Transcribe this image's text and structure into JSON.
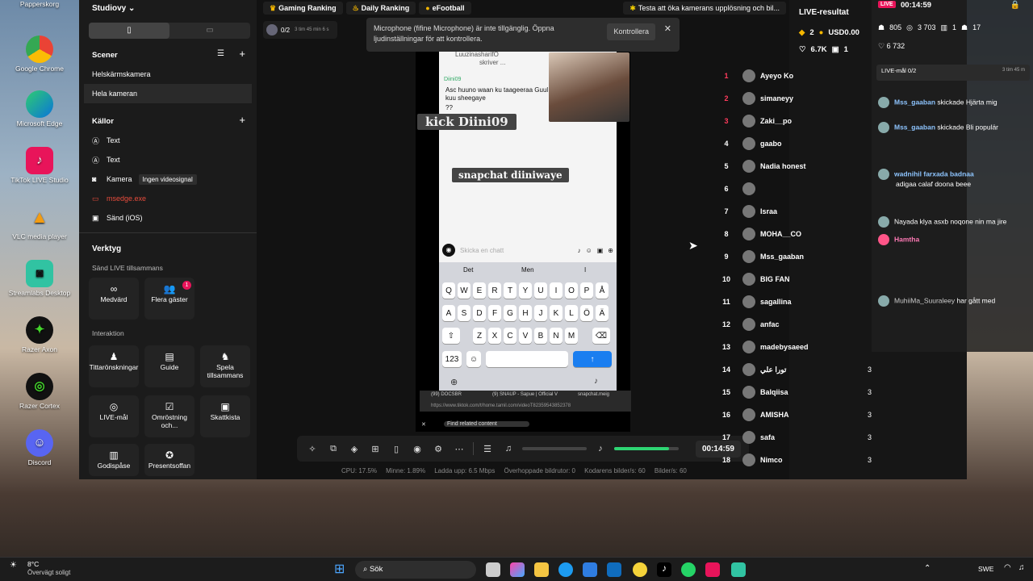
{
  "desktop": {
    "recycle_bin": "Papperskorg",
    "icons": [
      "Google Chrome",
      "Microsoft Edge",
      "TikTok LIVE Studio",
      "VLC media player",
      "Streamlabs Desktop",
      "Razer Axon",
      "Razer Cortex",
      "Discord"
    ]
  },
  "studio": {
    "menu": "Studiovy",
    "scenes": {
      "title": "Scener",
      "items": [
        "Helskärmskamera",
        "Hela kameran"
      ]
    },
    "sources": {
      "title": "Källor",
      "items": [
        "Text",
        "Text",
        "Kamera",
        "msedge.exe",
        "Sänd (iOS)"
      ],
      "camera_tooltip": "Ingen videosignal"
    },
    "tools": {
      "title": "Verktyg",
      "send_together": "Sänd LIVE tillsammans",
      "medvard": "Medvärd",
      "guests": "Flera gäster",
      "guests_badge": "1",
      "interaction": "Interaktion",
      "wishes": "Tittarönskningar",
      "guide": "Guide",
      "play_together": "Spela tillsammans",
      "goal": "LIVE-mål",
      "poll": "Omröstning och...",
      "chest": "Skattkista",
      "godispase": "Godispåse",
      "present": "Presentsoffan"
    }
  },
  "top": {
    "gaming": "Gaming Ranking",
    "daily": "Daily Ranking",
    "efootball": "eFootball",
    "tip": "Testa att öka kamerans upplösning och bil...",
    "goal": "0/2",
    "goal_time": "3 tim 45 min 6 s"
  },
  "toast": {
    "text": "Microphone (fifine Microphone) är inte tillgänglig. Öppna ljudinställningar för att kontrollera.",
    "button": "Kontrollera"
  },
  "phone": {
    "username": "LuuzinasharifO",
    "writing": "skriver ...",
    "msg_name": "Diini09",
    "msg": "Asc huuno waan ku taageeraa Guul kuu sheegaye",
    "msg_q": "??",
    "kick": "kick Diini09",
    "snap": "snapchat diiniwaye",
    "chat_placeholder": "Skicka en chatt",
    "suggest": [
      "Det",
      "Men",
      "I"
    ],
    "row1": [
      "Q",
      "W",
      "E",
      "R",
      "T",
      "Y",
      "U",
      "I",
      "O",
      "P",
      "Å"
    ],
    "row2": [
      "A",
      "S",
      "D",
      "F",
      "G",
      "H",
      "J",
      "K",
      "L",
      "Ö",
      "Ä"
    ],
    "row3": [
      "Z",
      "X",
      "C",
      "V",
      "B",
      "N",
      "M"
    ],
    "num": "123",
    "tabs": [
      "(99) DOCSBR",
      "(9) SNAUP - Sapue | Official V",
      "snapchat.meig",
      "(8) Search"
    ],
    "url": "https://www.tiktok.com/t/home.tamil.com/videoT82359543852378",
    "related": "Find related content"
  },
  "controls": {
    "time": "00:14:59",
    "volume_pct": 85
  },
  "stats": {
    "cpu": "CPU: 17.5%",
    "mem": "Minne: 1.89%",
    "upload": "Ladda upp: 6.5 Mbps",
    "dropped": "Överhoppade bildrutor: 0",
    "encoder": "Kodarens bilder/s: 60",
    "fps": "Bilder/s: 60"
  },
  "live": {
    "title": "LIVE-resultat",
    "diamonds": "2",
    "usd": "USD0.00",
    "likes": "6.7K",
    "gifts": "1",
    "ranks": [
      {
        "n": "1",
        "name": "Ayeyo Ko"
      },
      {
        "n": "2",
        "name": "simaneyy"
      },
      {
        "n": "3",
        "name": "Zaki__po"
      },
      {
        "n": "4",
        "name": "gaabo"
      },
      {
        "n": "5",
        "name": "Nadia honest"
      },
      {
        "n": "6",
        "name": ""
      },
      {
        "n": "7",
        "name": "Israa"
      },
      {
        "n": "8",
        "name": "MOHA__CO"
      },
      {
        "n": "9",
        "name": "Mss_gaaban"
      },
      {
        "n": "10",
        "name": "BIG FAN"
      },
      {
        "n": "11",
        "name": "sagallina"
      },
      {
        "n": "12",
        "name": "anfac"
      },
      {
        "n": "13",
        "name": "madebysaeed"
      },
      {
        "n": "14",
        "name": "تورا علي",
        "score": "3"
      },
      {
        "n": "15",
        "name": "Balqiisa",
        "score": "3"
      },
      {
        "n": "16",
        "name": "AMISHA",
        "score": "3"
      },
      {
        "n": "17",
        "name": "safa",
        "score": "3"
      },
      {
        "n": "18",
        "name": "Nimco",
        "score": "3"
      }
    ]
  },
  "overlay": {
    "live": "LIVE",
    "time": "00:14:59",
    "viewers": "805",
    "v2": "3 703",
    "v3": "1",
    "v4": "17",
    "likes": "6 732",
    "goal": "LIVE-mål 0/2",
    "goal_time": "3 tim 45 m",
    "chat": [
      {
        "user": "Mss_gaaban",
        "text": "skickade Hjärta mig"
      },
      {
        "user": "Mss_gaaban",
        "text": "skickade Bli populär"
      },
      {
        "user": "wadnihil farxada badnaa",
        "text": "adigaa calaf doona beee"
      },
      {
        "user": "",
        "text": "Nayada klya asxb noqone nin ma jire"
      },
      {
        "user": "Hamtha",
        "text": ""
      },
      {
        "user": "",
        "text": ""
      },
      {
        "user": "MuhiiMa_Suuraleey",
        "text": "har gått med"
      }
    ]
  },
  "taskbar": {
    "temp": "8°C",
    "weather": "Övervägt soligt",
    "search": "Sök",
    "lang": "SWE"
  }
}
